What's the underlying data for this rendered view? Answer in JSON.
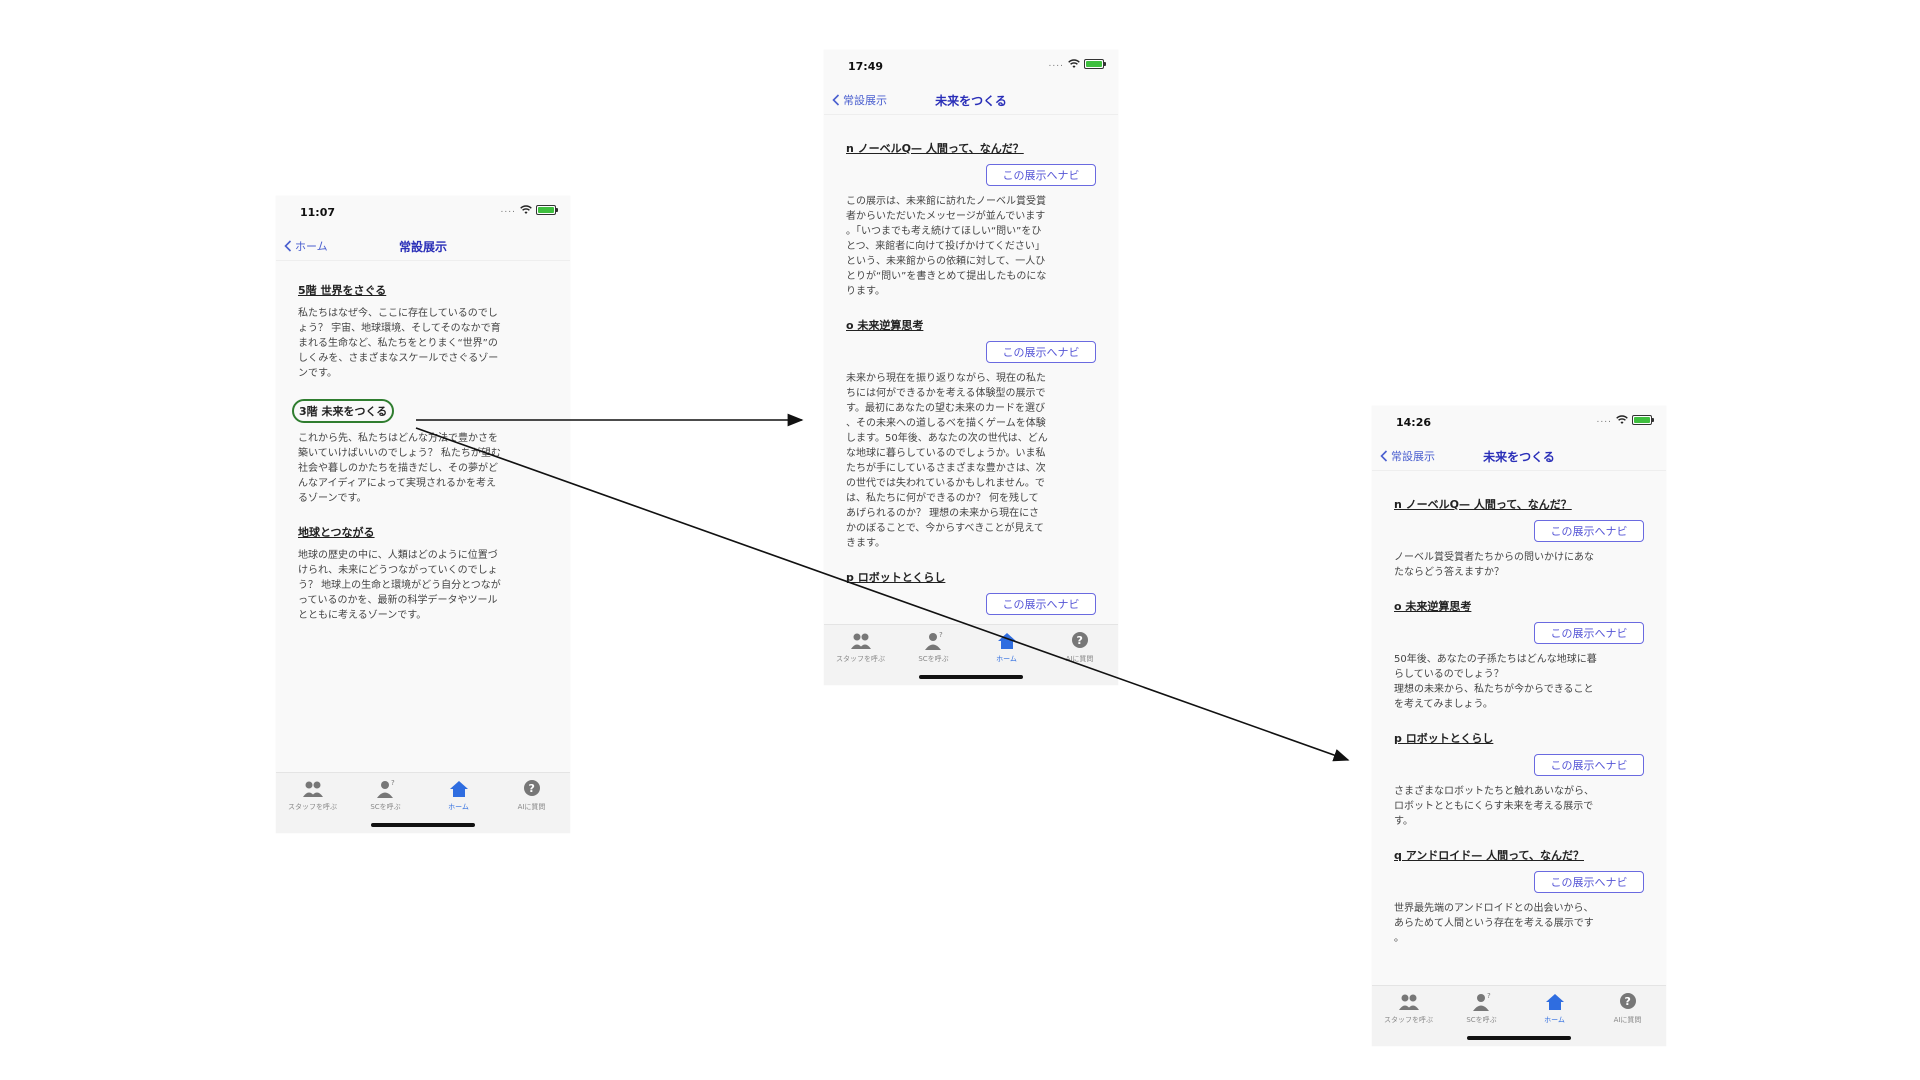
{
  "phones": {
    "p1": {
      "time": "11:07",
      "back_label": "ホーム",
      "title": "常設展示",
      "sections": [
        {
          "title": "5階 世界をさぐる",
          "body": "私たちはなぜ今、ここに存在しているのでし\nょう？ 宇宙、地球環境、そしてそのなかで育\nまれる生命など、私たちをとりまく“世界”の\nしくみを、さまざまなスケールでさぐるゾー\nンです。"
        },
        {
          "title": "3階 未来をつくる",
          "body": "これから先、私たちはどんな方法で豊かさを\n築いていけばいいのでしょう？ 私たちが望む\n社会や暮しのかたちを描きだし、その夢がど\nんなアイディアによって実現されるかを考え\nるゾーンです。"
        },
        {
          "title": "地球とつながる",
          "body": "地球の歴史の中に、人類はどのように位置づ\nけられ、未来にどうつながっていくのでしょ\nう？ 地球上の生命と環境がどう自分とつなが\nっているのかを、最新の科学データやツール\nとともに考えるゾーンです。"
        }
      ]
    },
    "p2": {
      "time": "17:49",
      "back_label": "常設展示",
      "title": "未来をつくる",
      "navi_label": "この展示へナビ",
      "sections": [
        {
          "title": "n ノーベルQ— 人間って、なんだ？",
          "body": "この展示は、未来館に訪れたノーベル賞受賞\n者からいただいたメッセージが並んでいます\n。「いつまでも考え続けてほしい“問い”をひ\nとつ、来館者に向けて投げかけてください」\nという、未来館からの依頼に対して、一人ひ\nとりが“問い”を書きとめて提出したものにな\nります。"
        },
        {
          "title": "o 未来逆算思考",
          "body": "未来から現在を振り返りながら、現在の私た\nちには何ができるかを考える体験型の展示で\nす。最初にあなたの望む未来のカードを選び\n、その未来への道しるべを描くゲームを体験\nします。50年後、あなたの次の世代は、どん\nな地球に暮らしているのでしょうか。いま私\nたちが手にしているさまざまな豊かさは、次\nの世代では失われているかもしれません。で\nは、私たちに何ができるのか？ 何を残して\nあげられるのか？ 理想の未来から現在にさ\nかのぼることで、今からすべきことが見えて\nきます。"
        },
        {
          "title": "p ロボットとくらし",
          "body": ""
        }
      ]
    },
    "p3": {
      "time": "14:26",
      "back_label": "常設展示",
      "title": "未来をつくる",
      "navi_label": "この展示へナビ",
      "sections": [
        {
          "title": "n ノーベルQ— 人間って、なんだ？",
          "body": "ノーベル賞受賞者たちからの問いかけにあな\nたならどう答えますか？"
        },
        {
          "title": "o 未来逆算思考",
          "body": "50年後、あなたの子孫たちはどんな地球に暮\nらしているのでしょう？\n理想の未来から、私たちが今からできること\nを考えてみましょう。"
        },
        {
          "title": "p ロボットとくらし",
          "body": "さまざまなロボットたちと触れあいながら、\nロボットとともにくらす未来を考える展示で\nす。"
        },
        {
          "title": "q アンドロイド— 人間って、なんだ？",
          "body": "世界最先端のアンドロイドとの出会いから、\nあらためて人間という存在を考える展示です\n。"
        }
      ]
    }
  },
  "tabs": [
    "スタッフを呼ぶ",
    "SCを呼ぶ",
    "ホーム",
    "AIに質問"
  ],
  "icons": [
    "staff-group-icon",
    "person-question-icon",
    "home-icon",
    "help-question-icon",
    "wifi-icon",
    "battery-icon",
    "chevron-left-icon"
  ],
  "colors": {
    "accent": "#2f6de0",
    "nav_title": "#2a2fb8",
    "highlight_circle": "#2f7d2f",
    "button_border": "#6a6ae0"
  }
}
